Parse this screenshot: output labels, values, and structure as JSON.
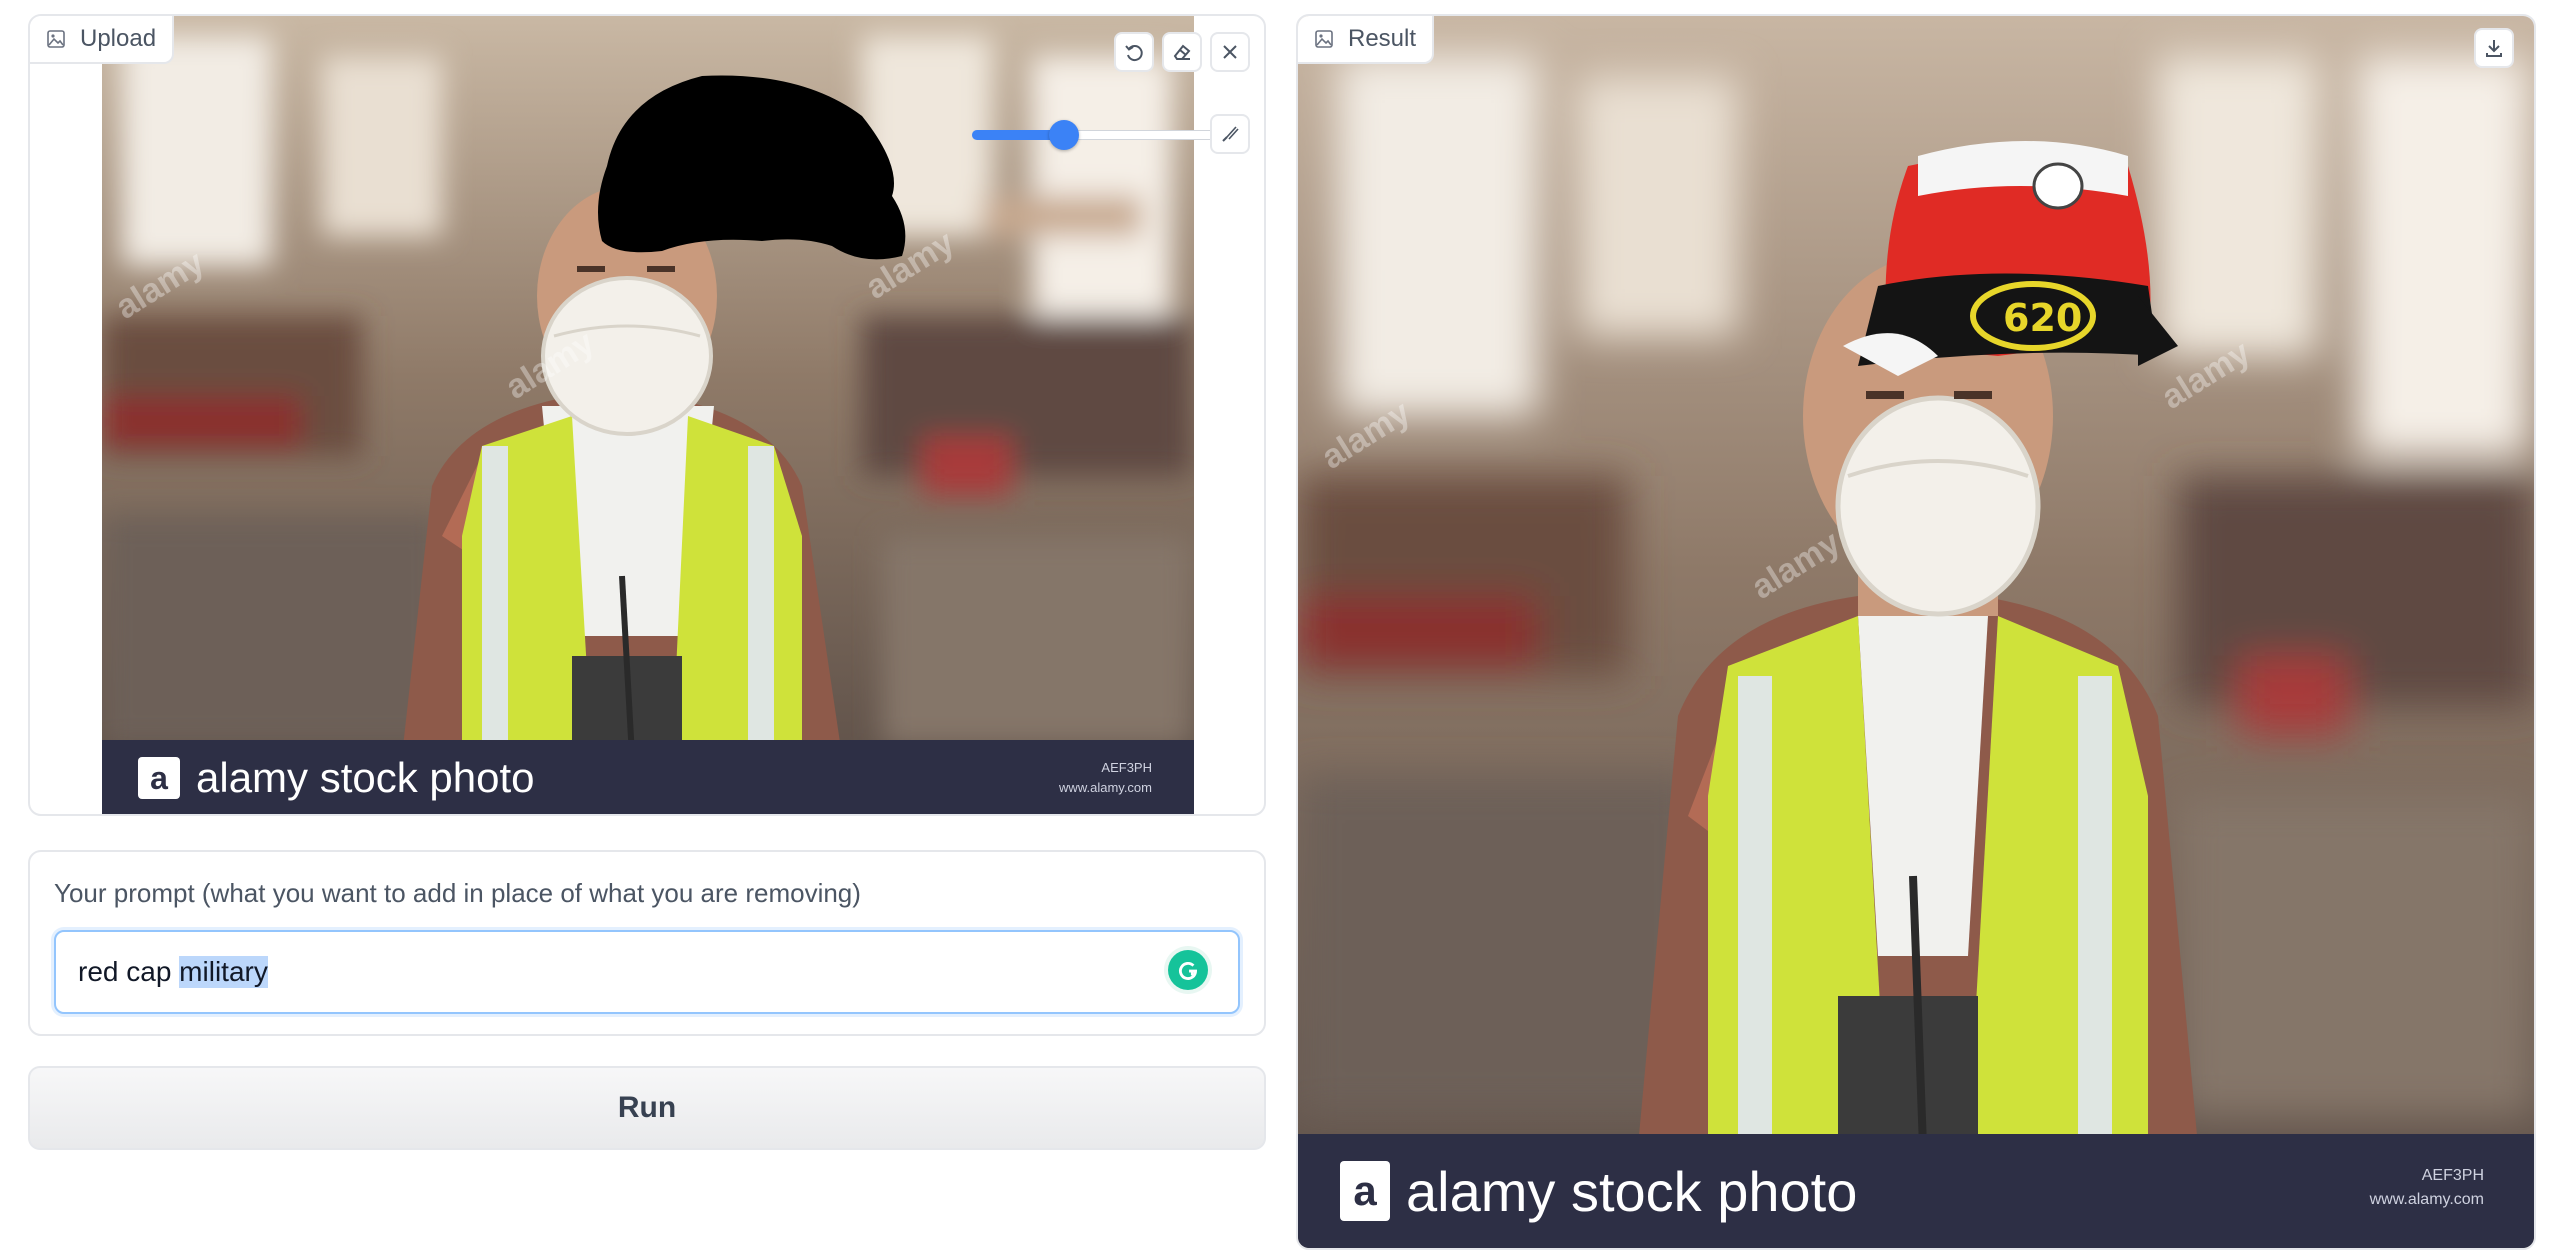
{
  "upload": {
    "label": "Upload",
    "photo_brand": "alamy stock photo",
    "photo_logo_letter": "a",
    "photo_meta_1": "AEF3PH",
    "photo_meta_2": "www.alamy.com",
    "watermark": "alamy",
    "toolbar": {
      "undo": "undo-icon",
      "eraser": "eraser-icon",
      "clear": "close-icon",
      "brush": "brush-icon"
    },
    "brush_size_fraction": 0.36
  },
  "prompt": {
    "label": "Your prompt (what you want to add in place of what you are removing)",
    "value_plain": "red cap ",
    "value_selected": "military"
  },
  "run": {
    "label": "Run"
  },
  "result": {
    "label": "Result",
    "photo_brand": "alamy stock photo",
    "photo_logo_letter": "a",
    "photo_meta_1": "AEF3PH",
    "photo_meta_2": "www.alamy.com",
    "watermark": "alamy",
    "toolbar": {
      "download": "download-icon"
    }
  },
  "colors": {
    "accent": "#3b82f6",
    "border": "#e5e7eb",
    "vest": "#d4e53a",
    "stripe": "#2d2f45",
    "grammarly": "#15c39a"
  }
}
